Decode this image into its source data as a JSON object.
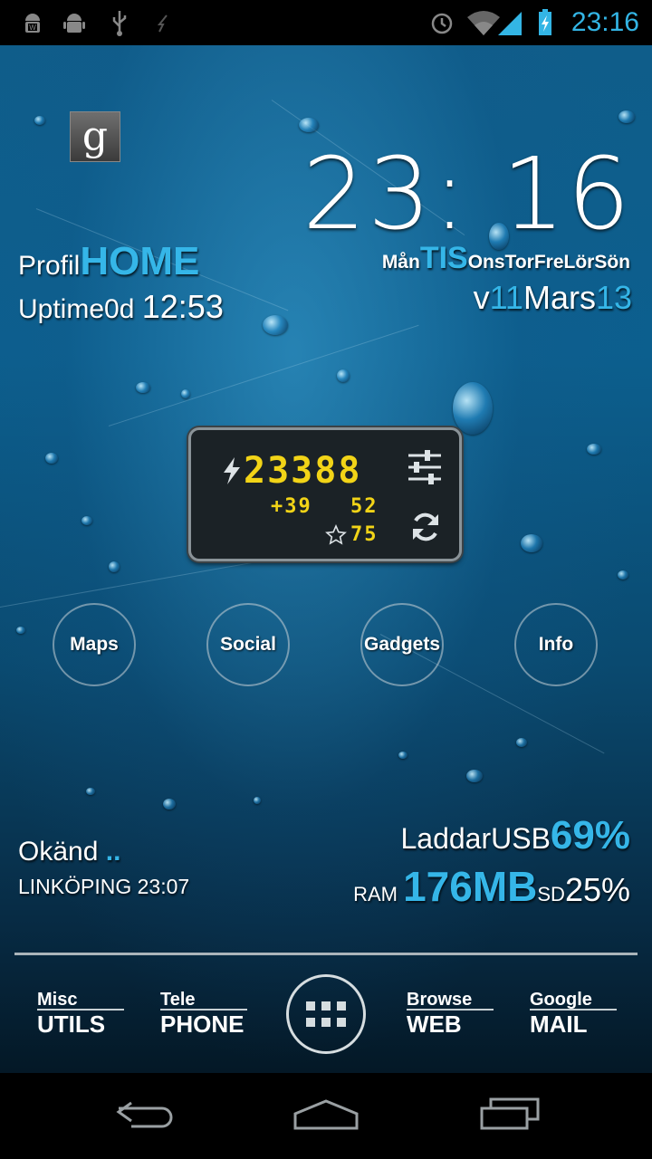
{
  "status_bar": {
    "time": "23:16",
    "left_icons": [
      "android-notification-icon",
      "android-debug-icon",
      "usb-icon",
      "flash-icon"
    ],
    "right_icons": [
      "alarm-icon",
      "wifi-icon",
      "signal-icon",
      "battery-charging-icon"
    ]
  },
  "clock": {
    "time": "23: 16"
  },
  "profile": {
    "label": "Profil",
    "value": "HOME"
  },
  "uptime": {
    "label": "Uptime",
    "days": "0d",
    "time": "12:53"
  },
  "weekdays": {
    "before": "Mån",
    "current": "TIS",
    "after": "OnsTorFreLörSön"
  },
  "date": {
    "prefix": "v",
    "week": "11",
    "month": "Mars",
    "day": "13"
  },
  "battery_widget": {
    "main_value": "23388",
    "sub_value_1": "+39",
    "sub_value_2": "52",
    "rating": "75"
  },
  "circles": [
    {
      "label": "Maps"
    },
    {
      "label": "Social"
    },
    {
      "label": "Gadgets"
    },
    {
      "label": "Info"
    }
  ],
  "weather": {
    "condition": "Okänd",
    "dots": "..",
    "location_time": "LINKÖPING 23:07"
  },
  "battery": {
    "label": "Laddar",
    "source": "USB",
    "percent": "69%"
  },
  "memory": {
    "ram_label": "RAM",
    "ram_value": "176MB",
    "sd_label": "SD",
    "sd_value": "25%"
  },
  "dock": [
    {
      "small": "Misc",
      "big": "UTILS"
    },
    {
      "small": "Tele",
      "big": "PHONE"
    },
    {
      "small": "Browse",
      "big": "WEB"
    },
    {
      "small": "Google",
      "big": "MAIL"
    }
  ],
  "google_letter": "g",
  "colors": {
    "accent": "#35b6e8",
    "segment": "#f2d417"
  }
}
